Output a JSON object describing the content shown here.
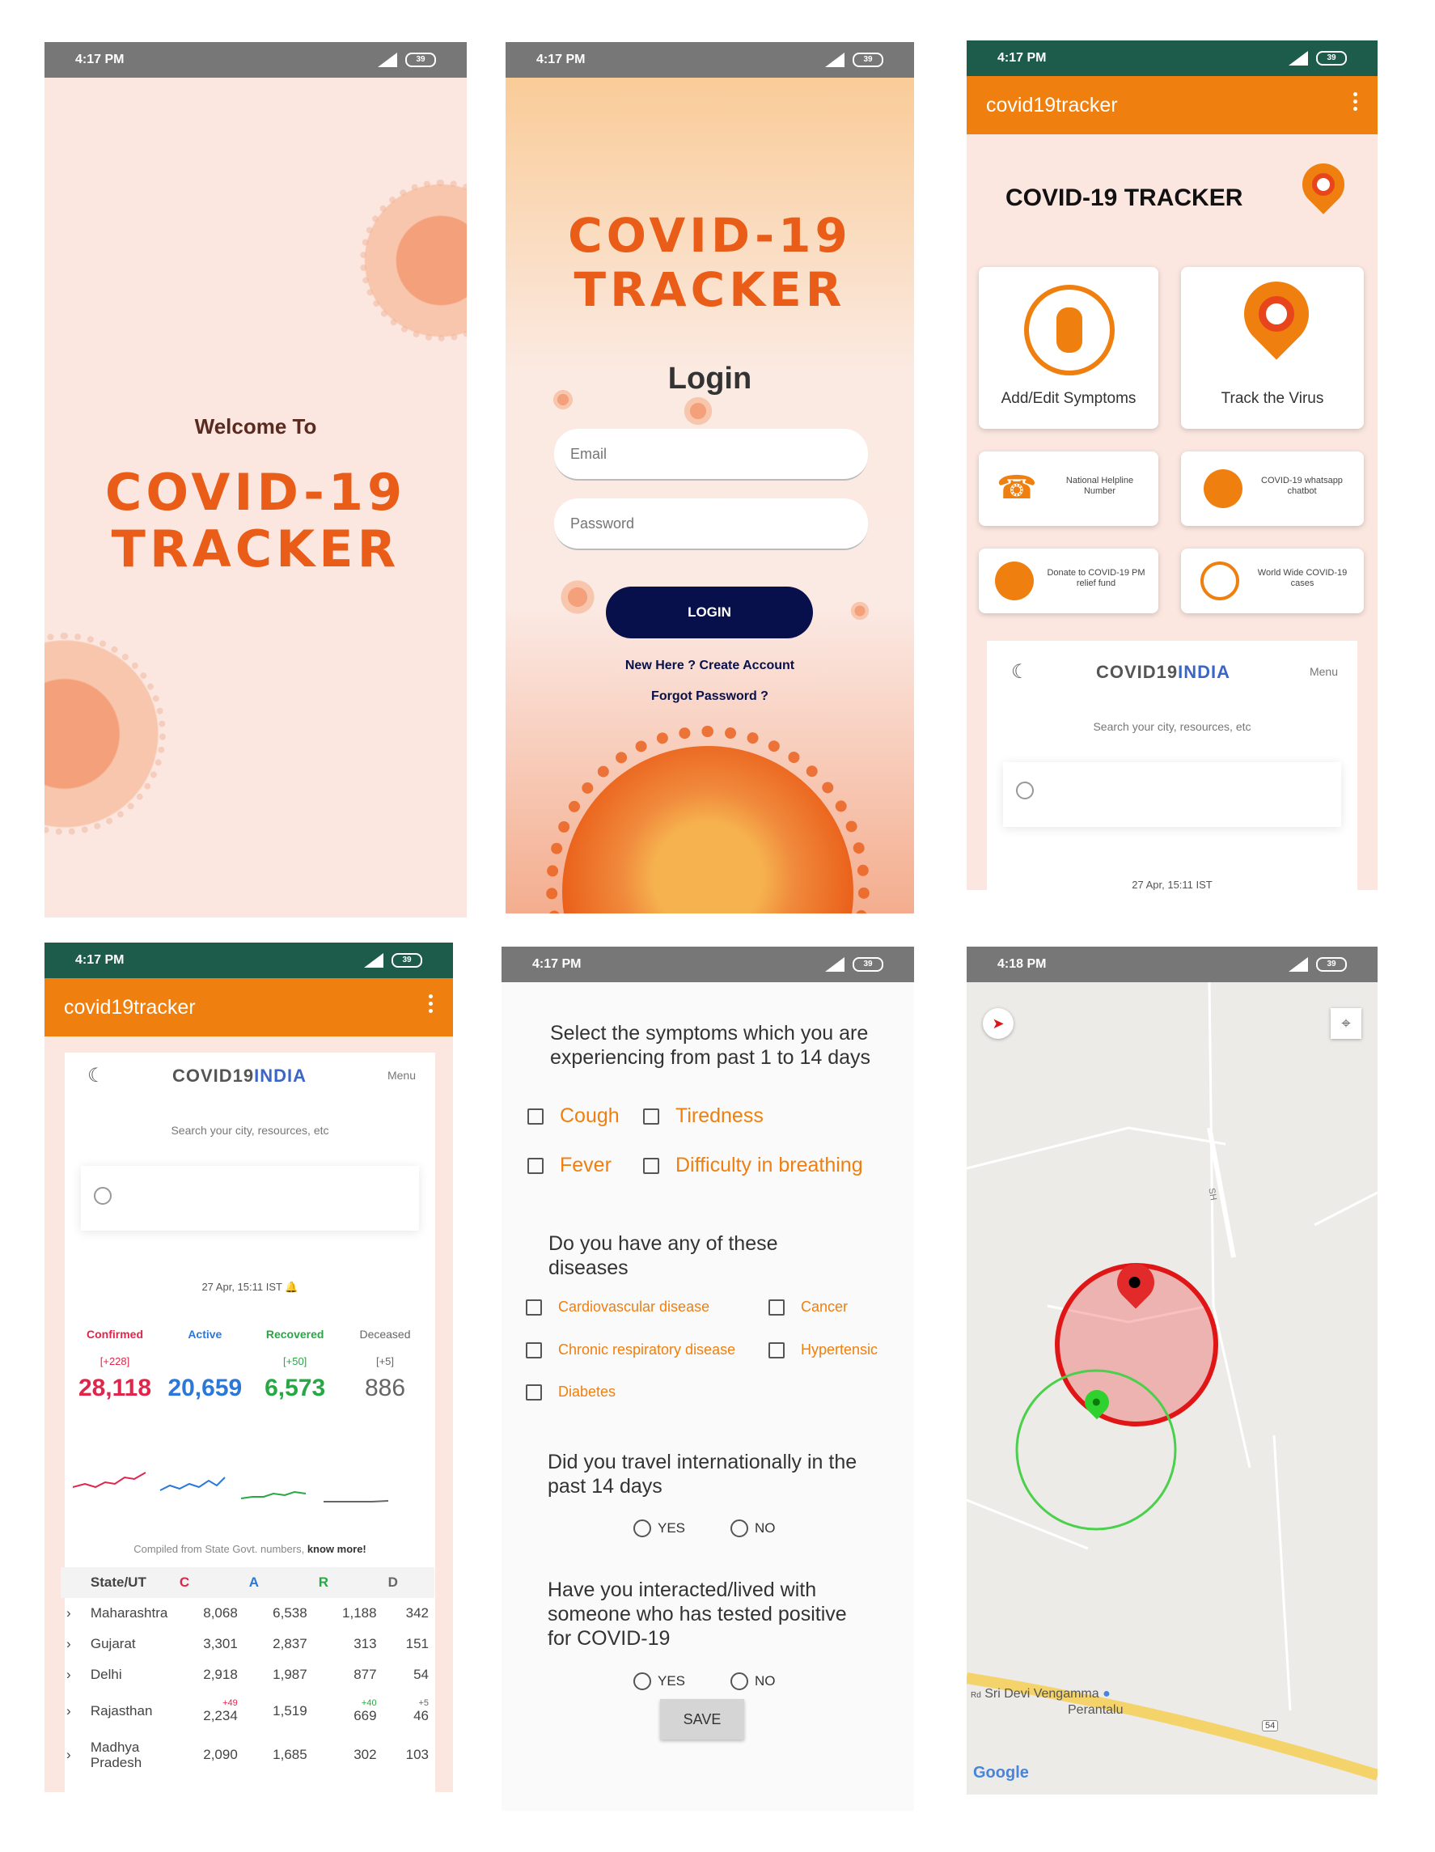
{
  "status": {
    "time1": "4:17 PM",
    "time2": "4:18 PM",
    "battery": "39"
  },
  "splash": {
    "welcome": "Welcome To",
    "logo_line1": "COVID-19",
    "logo_line2": "TRACKER"
  },
  "login": {
    "logo_line1": "COVID-19",
    "logo_line2": "TRACKER",
    "heading": "Login",
    "email_placeholder": "Email",
    "password_placeholder": "Password",
    "button": "LOGIN",
    "new_here": "New Here ? ",
    "create_account": "Create Account",
    "forgot": "Forgot Password ?"
  },
  "home": {
    "app_title": "covid19tracker",
    "heading": "COVID-19 TRACKER",
    "big_tiles": [
      {
        "label": "Add/Edit Symptoms"
      },
      {
        "label": "Track the Virus"
      }
    ],
    "small_tiles": [
      {
        "label": "National Helpline Number"
      },
      {
        "label": "COVID-19 whatsapp chatbot"
      },
      {
        "label": "Donate to COVID-19 PM relief fund"
      },
      {
        "label": "World Wide COVID-19 cases"
      }
    ],
    "web_brand_a": "COVID19",
    "web_brand_b": "INDIA",
    "web_menu": "Menu",
    "web_search_hint": "Search your city, resources, etc",
    "web_timestamp": "27 Apr, 15:11 IST"
  },
  "stats": {
    "app_title": "covid19tracker",
    "brand_a": "COVID19",
    "brand_b": "INDIA",
    "menu": "Menu",
    "search_hint": "Search your city, resources, etc",
    "timestamp": "27 Apr, 15:11 IST",
    "columns": [
      {
        "label": "Confirmed",
        "delta": "[+228]",
        "value": "28,118",
        "color": "#e0254a"
      },
      {
        "label": "Active",
        "delta": "",
        "value": "20,659",
        "color": "#2b78d8"
      },
      {
        "label": "Recovered",
        "delta": "[+50]",
        "value": "6,573",
        "color": "#28a745"
      },
      {
        "label": "Deceased",
        "delta": "[+5]",
        "value": "886",
        "color": "#666666"
      }
    ],
    "compiled_text": "Compiled from State Govt. numbers, ",
    "compiled_link": "know more!",
    "table_headers": [
      "State/UT",
      "C",
      "A",
      "R",
      "D"
    ],
    "rows": [
      {
        "state": "Maharashtra",
        "c": "8,068",
        "a": "6,538",
        "r": "1,188",
        "d": "342",
        "dc": "",
        "dr": "",
        "dd": ""
      },
      {
        "state": "Gujarat",
        "c": "3,301",
        "a": "2,837",
        "r": "313",
        "d": "151",
        "dc": "",
        "dr": "",
        "dd": ""
      },
      {
        "state": "Delhi",
        "c": "2,918",
        "a": "1,987",
        "r": "877",
        "d": "54",
        "dc": "",
        "dr": "",
        "dd": ""
      },
      {
        "state": "Rajasthan",
        "c": "2,234",
        "a": "1,519",
        "r": "669",
        "d": "46",
        "dc": "+49",
        "dr": "+40",
        "dd": "+5"
      },
      {
        "state": "Madhya Pradesh",
        "c": "2,090",
        "a": "1,685",
        "r": "302",
        "d": "103",
        "dc": "",
        "dr": "",
        "dd": ""
      }
    ]
  },
  "symptoms": {
    "q1": "Select the symptoms which you are experiencing from past 1 to 14 days",
    "symptoms": [
      "Cough",
      "Tiredness",
      "Fever",
      "Difficulty in breathing"
    ],
    "q2": "Do you have any of these diseases",
    "diseases": [
      "Cardiovascular disease",
      "Cancer",
      "Chronic respiratory disease",
      "Hypertensic",
      "Diabetes"
    ],
    "q3": "Did you travel internationally in the past 14 days",
    "q4": "Have you interacted/lived with someone who has tested positive for COVID-19",
    "yes": "YES",
    "no": "NO",
    "save": "SAVE"
  },
  "map": {
    "place_line1": "Sri Devi Vengamma",
    "place_line2": "Perantalu",
    "place_prefix": "Rd",
    "road_badge": "54",
    "road_label": "SH",
    "brand": "Google"
  }
}
